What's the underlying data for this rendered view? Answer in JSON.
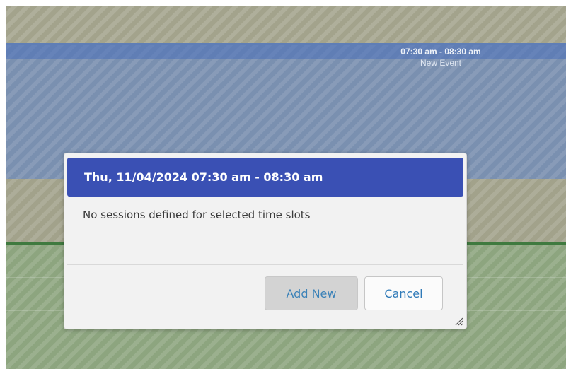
{
  "calendar": {
    "event": {
      "time_range": "07:30 am - 08:30 am",
      "title": "New Event"
    }
  },
  "dialog": {
    "title": "Thu, 11/04/2024 07:30 am - 08:30 am",
    "message": "No sessions defined for selected time slots",
    "buttons": {
      "add_new": "Add New",
      "cancel": "Cancel"
    }
  },
  "colors": {
    "dialog_header": "#3a50b4",
    "event_block": "#7a90b0",
    "button_text": "#3b82b8"
  },
  "icons": {
    "resize": "resize-grip-icon"
  }
}
